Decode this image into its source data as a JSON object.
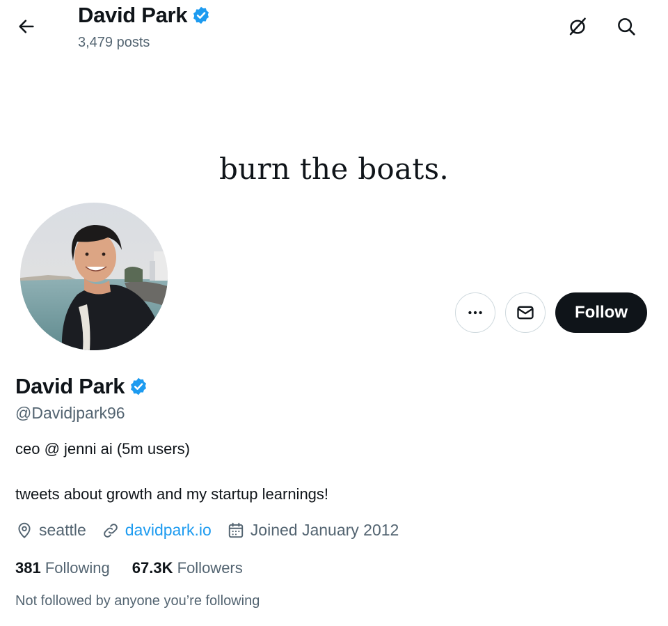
{
  "header": {
    "name": "David Park",
    "posts": "3,479 posts"
  },
  "banner": {
    "text": "burn the boats."
  },
  "profile": {
    "name": "David Park",
    "handle": "@Davidjpark96",
    "bio_line1": "ceo @ jenni ai (5m users)",
    "bio_line2": "tweets about growth and my startup learnings!",
    "location": "seattle",
    "website": "davidpark.io",
    "joined": "Joined January 2012",
    "following_count": "381",
    "following_label": "Following",
    "followers_count": "67.3K",
    "followers_label": "Followers",
    "not_followed": "Not followed by anyone you’re following"
  },
  "actions": {
    "follow_label": "Follow"
  },
  "colors": {
    "verified": "#1d9bf0",
    "follow_bg": "#0f1419",
    "secondary_text": "#536471",
    "link": "#1d9bf0"
  },
  "icons": {
    "back": "arrow-left-icon",
    "top_1": "grok-icon",
    "top_2": "search-icon",
    "more": "more-icon",
    "message": "mail-icon",
    "location": "location-pin-icon",
    "link": "link-icon",
    "calendar": "calendar-icon",
    "verified": "verified-badge-icon"
  }
}
